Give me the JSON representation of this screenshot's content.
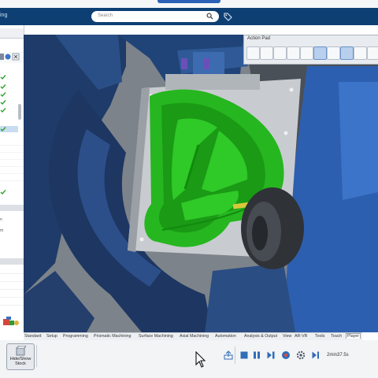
{
  "header": {
    "brand_fragment": "ing",
    "search_placeholder": "Search"
  },
  "action_pad": {
    "title": "Action Pad",
    "tools": [
      "shaded-view",
      "tool-1",
      "tool-2",
      "tool-3",
      "tool-4",
      "tool-5",
      "tool-6",
      "tool-7",
      "tool-8",
      "tool-9"
    ]
  },
  "left_panel": {
    "row_partial_1": "n",
    "row_partial_2": "m"
  },
  "tabs": [
    "Standard",
    "Setup",
    "Programming",
    "Prismatic Machining",
    "Surface Machining",
    "Axial Machining",
    "Automation",
    "Analysis & Output",
    "View",
    "AR-VR",
    "Tools",
    "Touch",
    "Player"
  ],
  "active_tab": "Player",
  "player": {
    "hide_show_line1": "Hide/Show",
    "hide_show_line2": "Stock",
    "elapsed": "2min37.5s"
  },
  "colors": {
    "header": "#0d3f73",
    "accent": "#2b62b8",
    "part_green": "#22b41e",
    "machine_blue": "#2d5fb0"
  }
}
